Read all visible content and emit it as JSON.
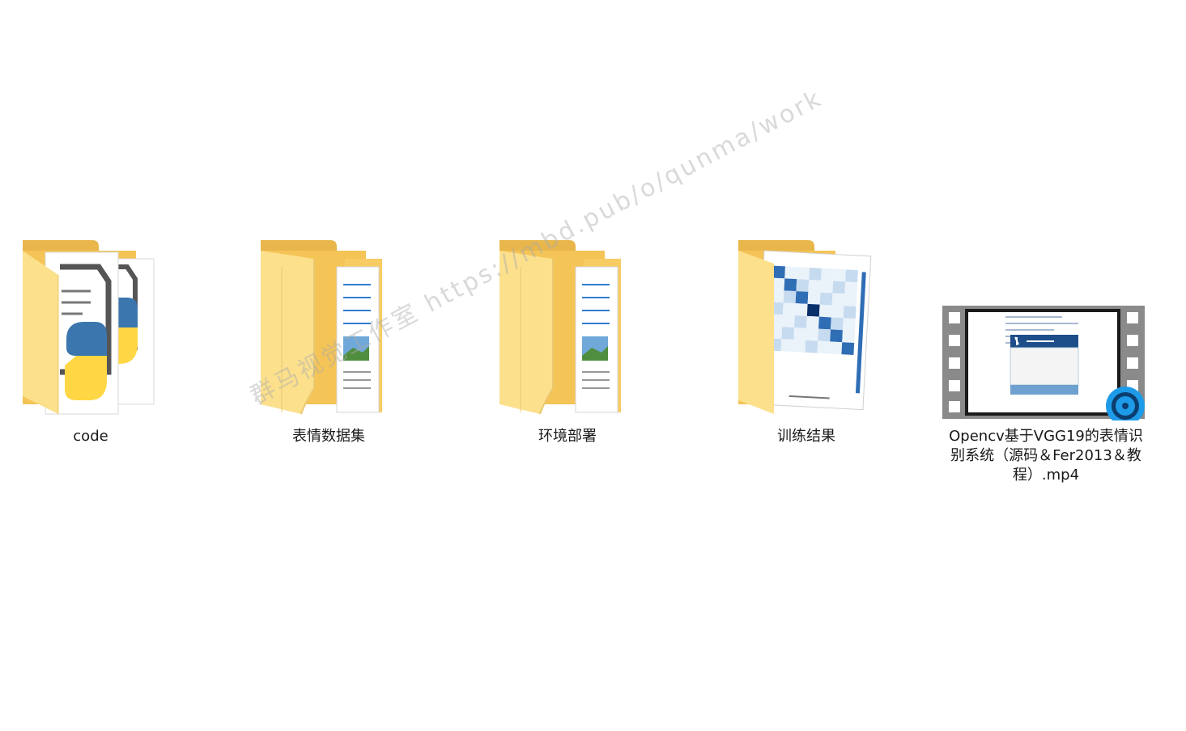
{
  "items": [
    {
      "name": "code",
      "type": "folder",
      "preview": "python-files"
    },
    {
      "name": "表情数据集",
      "type": "folder",
      "preview": "document"
    },
    {
      "name": "环境部署",
      "type": "folder",
      "preview": "document"
    },
    {
      "name": "训练结果",
      "type": "folder",
      "preview": "confusion-matrix"
    },
    {
      "name": "Opencv基于VGG19的表情识别系统（源码＆Fer2013＆教程）.mp4",
      "type": "video",
      "preview": "video-frame"
    }
  ],
  "watermark": "群马视觉工作室 https://mbd.pub/o/qunma/work",
  "colors": {
    "folder_back": "#F5C456",
    "folder_front": "#FCE08C",
    "player_blue": "#1E9BE8"
  }
}
